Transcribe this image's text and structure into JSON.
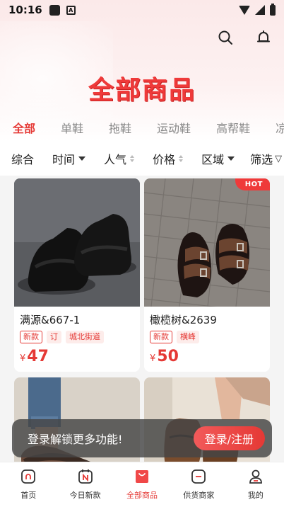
{
  "status_bar": {
    "time": "10:16",
    "icon_a": "A"
  },
  "header": {
    "search_icon": "search-icon",
    "bell_icon": "bell-icon"
  },
  "page_title": "全部商品",
  "categories": [
    "全部",
    "单鞋",
    "拖鞋",
    "运动鞋",
    "高帮鞋",
    "凉鞋"
  ],
  "active_category": "全部",
  "filters": {
    "comprehensive": "综合",
    "time": "时间",
    "popularity": "人气",
    "price": "价格",
    "region": "区域",
    "filter": "筛选"
  },
  "products": [
    {
      "name": "满源&667-1",
      "tags": [
        "新款",
        "订",
        "城北街道"
      ],
      "currency": "¥",
      "price": "47",
      "hot": false
    },
    {
      "name": "橄榄树&2639",
      "tags": [
        "新款",
        "横峰"
      ],
      "currency": "¥",
      "price": "50",
      "hot": true,
      "hot_label": "HOT"
    },
    {
      "name": "",
      "tags": [],
      "currency": "",
      "price": "",
      "hot": false
    },
    {
      "name": "",
      "tags": [],
      "currency": "",
      "price": "",
      "hot": false
    }
  ],
  "login_banner": {
    "text": "登录解锁更多功能!",
    "button": "登录/注册"
  },
  "bottom_nav": {
    "items": [
      {
        "label": "首页",
        "icon": "home-icon"
      },
      {
        "label": "今日新款",
        "icon": "calendar-new-icon"
      },
      {
        "label": "全部商品",
        "icon": "bag-icon",
        "active": true
      },
      {
        "label": "供货商家",
        "icon": "supplier-icon"
      },
      {
        "label": "我的",
        "icon": "user-icon"
      }
    ]
  },
  "colors": {
    "accent": "#e53935",
    "title": "#ef3a3a"
  }
}
